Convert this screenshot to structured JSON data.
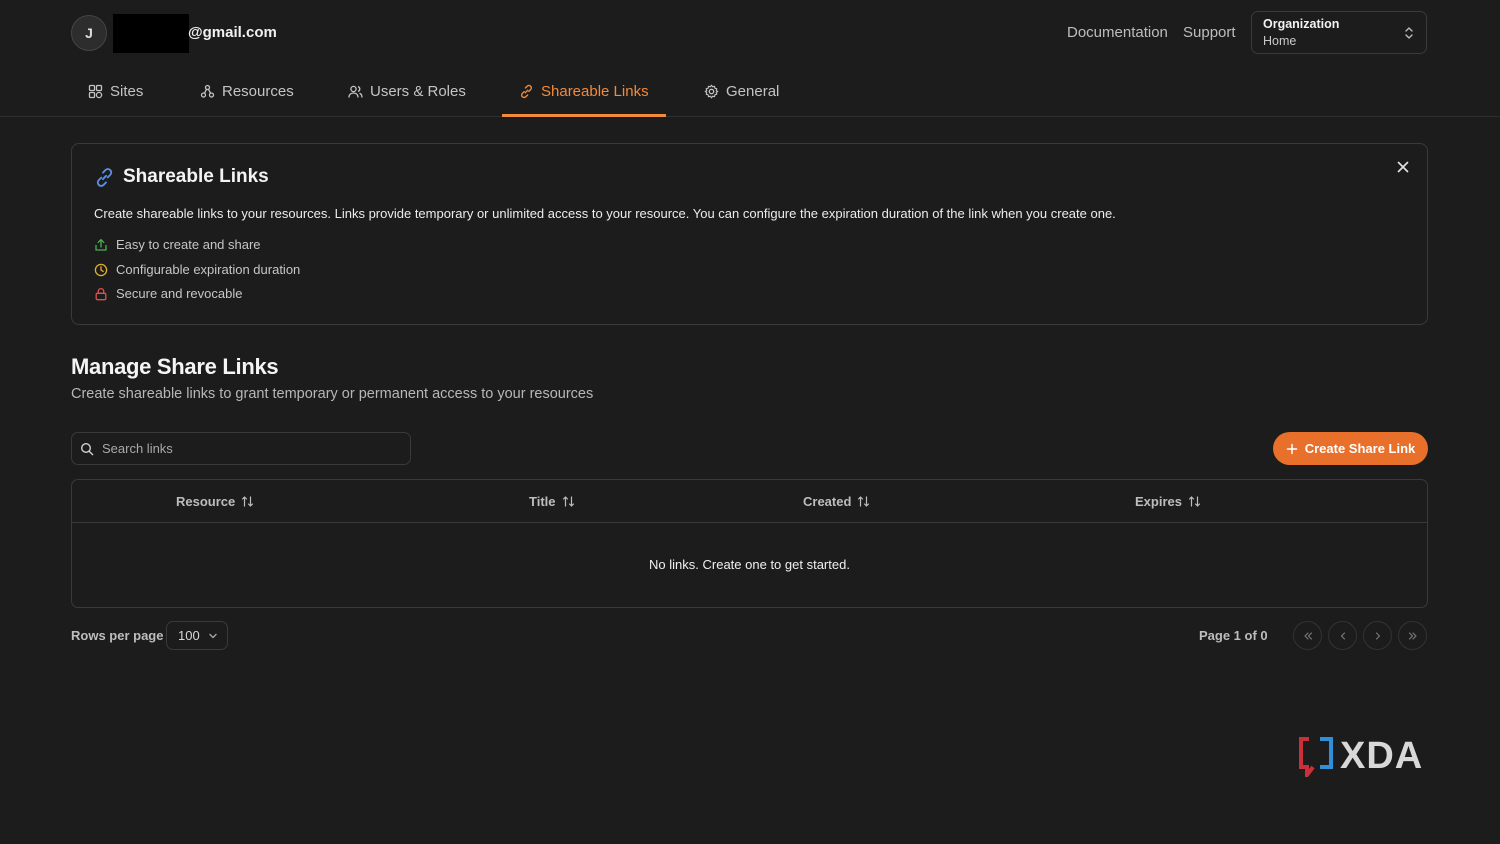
{
  "header": {
    "avatar_initial": "J",
    "email_visible": "@gmail.com",
    "links": [
      "Documentation",
      "Support"
    ],
    "org": {
      "title": "Organization",
      "value": "Home"
    }
  },
  "tabs": [
    {
      "label": "Sites",
      "icon": "sites-icon"
    },
    {
      "label": "Resources",
      "icon": "resources-icon"
    },
    {
      "label": "Users & Roles",
      "icon": "users-icon"
    },
    {
      "label": "Shareable Links",
      "icon": "link-icon",
      "active": true
    },
    {
      "label": "General",
      "icon": "gear-icon"
    }
  ],
  "info": {
    "title": "Shareable Links",
    "description": "Create shareable links to your resources. Links provide temporary or unlimited access to your resource. You can configure the expiration duration of the link when you create one.",
    "features": [
      {
        "text": "Easy to create and share",
        "icon": "share-icon",
        "color": "#4caf50"
      },
      {
        "text": "Configurable expiration duration",
        "icon": "clock-icon",
        "color": "#e0b030"
      },
      {
        "text": "Secure and revocable",
        "icon": "lock-icon",
        "color": "#e05050"
      }
    ]
  },
  "manage": {
    "title": "Manage Share Links",
    "subtitle": "Create shareable links to grant temporary or permanent access to your resources",
    "search_placeholder": "Search links",
    "create_label": "Create Share Link"
  },
  "table": {
    "columns": [
      "Resource",
      "Title",
      "Created",
      "Expires"
    ],
    "empty_text": "No links. Create one to get started."
  },
  "pagination": {
    "rows_label": "Rows per page",
    "rows_value": "100",
    "page_text": "Page 1 of 0"
  },
  "watermark": "XDA",
  "colors": {
    "accent": "#e8702a",
    "background": "#1c1c1c",
    "link_icon": "#5b8fe6"
  }
}
